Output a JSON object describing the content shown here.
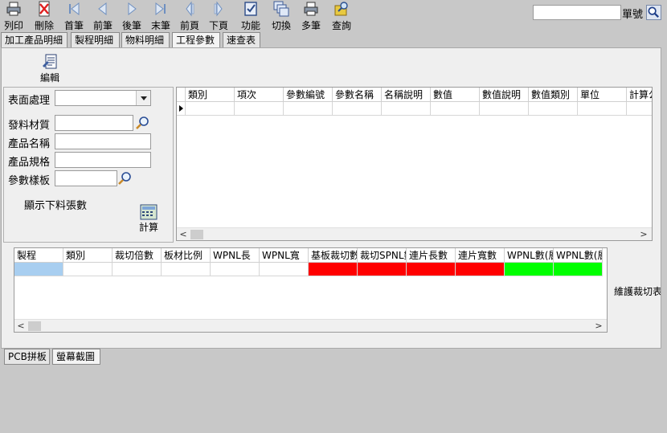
{
  "toolbar": {
    "buttons": [
      {
        "label": "列印",
        "icon": "printer-icon"
      },
      {
        "label": "刪除",
        "icon": "delete-icon"
      },
      {
        "label": "首筆",
        "icon": "first-record-icon"
      },
      {
        "label": "前筆",
        "icon": "previous-record-icon"
      },
      {
        "label": "後筆",
        "icon": "next-record-icon"
      },
      {
        "label": "末筆",
        "icon": "last-record-icon"
      },
      {
        "label": "前頁",
        "icon": "previous-page-icon"
      },
      {
        "label": "下頁",
        "icon": "next-page-icon"
      },
      {
        "label": "功能",
        "icon": "function-icon"
      },
      {
        "label": "切換",
        "icon": "switch-icon"
      },
      {
        "label": "多筆",
        "icon": "multi-record-icon"
      },
      {
        "label": "查詢",
        "icon": "query-icon"
      }
    ],
    "order_no_label": "單號",
    "order_no_value": ""
  },
  "tabs": [
    {
      "label": "加工產品明細",
      "active": false
    },
    {
      "label": "製程明細",
      "active": false
    },
    {
      "label": "物料明細",
      "active": false
    },
    {
      "label": "工程參數",
      "active": true
    },
    {
      "label": "速查表",
      "active": false
    }
  ],
  "edit_button": {
    "label": "編輯",
    "icon": "edit-icon"
  },
  "form": {
    "surface_treatment": {
      "label": "表面處理",
      "value": ""
    },
    "material": {
      "label": "發料材質",
      "value": ""
    },
    "product_name": {
      "label": "產品名稱",
      "value": ""
    },
    "product_spec": {
      "label": "產品規格",
      "value": ""
    },
    "param_template": {
      "label": "參數樣板",
      "value": ""
    },
    "show_count_label": "顯示下料張數",
    "calc_label": "計算"
  },
  "param_grid": {
    "columns": [
      "類別",
      "項次",
      "參數編號",
      "參數名稱",
      "名稱說明",
      "數值",
      "數值說明",
      "數值類別",
      "單位",
      "計算公"
    ]
  },
  "cut_grid": {
    "columns": [
      "製程",
      "類別",
      "裁切倍數",
      "板材比例",
      "WPNL長",
      "WPNL寬",
      "基板裁切數",
      "裁切SPNL數",
      "連片長數",
      "連片寬數",
      "WPNL數(層",
      "WPNL數(層"
    ],
    "row_colors": [
      "#a8cef0",
      "#ffffff",
      "#ffffff",
      "#ffffff",
      "#ffffff",
      "#ffffff",
      "#ff0000",
      "#ff0000",
      "#ff0000",
      "#ff0000",
      "#00ff00",
      "#00ff00"
    ],
    "maintain_label": "維護裁切表"
  },
  "bottom_tabs": [
    {
      "label": "PCB拼板",
      "active": false
    },
    {
      "label": "螢幕截圖",
      "active": true
    }
  ]
}
